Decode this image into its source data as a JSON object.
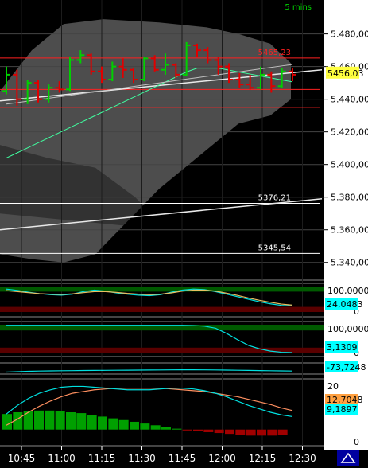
{
  "header": {
    "interval_label": "5 mins"
  },
  "colors": {
    "up": "#00d000",
    "down": "#e00000",
    "axis_bg": "#ffffff",
    "grid": "#444444",
    "band_fill": "#5a5a5a",
    "resistance": "#ff2020",
    "support_white": "#ffffff"
  },
  "chart_data": [
    {
      "type": "candlestick",
      "title": "",
      "x_ticks": [
        "10:45",
        "11:00",
        "11:15",
        "11:30",
        "11:45",
        "12:00",
        "12:15",
        "12:30"
      ],
      "y_ticks": [
        5480,
        5460,
        5440,
        5420,
        5400,
        5380,
        5360,
        5340
      ],
      "ylim": [
        5335,
        5492
      ],
      "last_price": "5456,03",
      "annotations": [
        {
          "text": "5465,23",
          "value": 5465.23,
          "color": "#ff2020"
        },
        {
          "text": "5376,21",
          "value": 5376.21,
          "color": "#ffffff"
        },
        {
          "text": "5345,54",
          "value": 5345.54,
          "color": "#ffffff"
        }
      ],
      "horizontal_lines": [
        {
          "value": 5465.23,
          "color": "#ff2020"
        },
        {
          "value": 5446,
          "color": "#ff2020"
        },
        {
          "value": 5435,
          "color": "#ff2020"
        },
        {
          "value": 5376.21,
          "color": "#ffffff"
        },
        {
          "value": 5345.54,
          "color": "#ffffff"
        }
      ],
      "bars": [
        {
          "time": "10:35",
          "o": 5445,
          "h": 5460,
          "l": 5443,
          "c": 5455
        },
        {
          "time": "10:40",
          "o": 5455,
          "h": 5458,
          "l": 5436,
          "c": 5440
        },
        {
          "time": "10:45",
          "o": 5440,
          "h": 5452,
          "l": 5437,
          "c": 5450
        },
        {
          "time": "10:50",
          "o": 5450,
          "h": 5452,
          "l": 5438,
          "c": 5440
        },
        {
          "time": "10:55",
          "o": 5440,
          "h": 5449,
          "l": 5438,
          "c": 5447
        },
        {
          "time": "11:00",
          "o": 5447,
          "h": 5451,
          "l": 5444,
          "c": 5446
        },
        {
          "time": "11:05",
          "o": 5446,
          "h": 5466,
          "l": 5445,
          "c": 5464
        },
        {
          "time": "11:10",
          "o": 5464,
          "h": 5470,
          "l": 5462,
          "c": 5467
        },
        {
          "time": "11:15",
          "o": 5467,
          "h": 5468,
          "l": 5455,
          "c": 5457
        },
        {
          "time": "11:20",
          "o": 5457,
          "h": 5460,
          "l": 5450,
          "c": 5452
        },
        {
          "time": "11:25",
          "o": 5452,
          "h": 5463,
          "l": 5451,
          "c": 5460
        },
        {
          "time": "11:30",
          "o": 5460,
          "h": 5465,
          "l": 5453,
          "c": 5458
        },
        {
          "time": "11:35",
          "o": 5458,
          "h": 5459,
          "l": 5450,
          "c": 5452
        },
        {
          "time": "11:40",
          "o": 5452,
          "h": 5466,
          "l": 5451,
          "c": 5465
        },
        {
          "time": "11:45",
          "o": 5465,
          "h": 5467,
          "l": 5457,
          "c": 5458
        },
        {
          "time": "11:50",
          "o": 5458,
          "h": 5468,
          "l": 5455,
          "c": 5461
        },
        {
          "time": "11:55",
          "o": 5461,
          "h": 5462,
          "l": 5453,
          "c": 5455
        },
        {
          "time": "12:00",
          "o": 5455,
          "h": 5475,
          "l": 5454,
          "c": 5473
        },
        {
          "time": "12:05",
          "o": 5473,
          "h": 5474,
          "l": 5466,
          "c": 5470
        },
        {
          "time": "12:10",
          "o": 5470,
          "h": 5472,
          "l": 5462,
          "c": 5464
        },
        {
          "time": "12:15",
          "o": 5464,
          "h": 5466,
          "l": 5455,
          "c": 5460
        },
        {
          "time": "12:20",
          "o": 5460,
          "h": 5462,
          "l": 5450,
          "c": 5452
        },
        {
          "time": "12:25",
          "o": 5452,
          "h": 5456,
          "l": 5447,
          "c": 5449
        },
        {
          "time": "12:30",
          "o": 5449,
          "h": 5455,
          "l": 5446,
          "c": 5447
        },
        {
          "time": "12:35",
          "o": 5447,
          "h": 5460,
          "l": 5446,
          "c": 5455
        },
        {
          "time": "12:40",
          "o": 5455,
          "h": 5457,
          "l": 5444,
          "c": 5448
        },
        {
          "time": "12:45",
          "o": 5448,
          "h": 5459,
          "l": 5447,
          "c": 5457
        },
        {
          "time": "12:50",
          "o": 5457,
          "h": 5459,
          "l": 5451,
          "c": 5455
        }
      ]
    },
    {
      "type": "line",
      "title": "",
      "y_ticks": [
        "100,0000",
        "0"
      ],
      "ylim": [
        0,
        100
      ],
      "last_value": "24,0483",
      "series": [
        {
          "color": "#00e0e0",
          "values": [
            90,
            85,
            78,
            72,
            68,
            66,
            70,
            80,
            86,
            82,
            75,
            70,
            66,
            64,
            68,
            78,
            86,
            90,
            88,
            80,
            70,
            60,
            50,
            40,
            32,
            26,
            24
          ]
        },
        {
          "color": "#e8c060",
          "values": [
            84,
            80,
            76,
            72,
            70,
            69,
            71,
            76,
            80,
            80,
            77,
            73,
            70,
            68,
            70,
            75,
            82,
            86,
            86,
            82,
            74,
            65,
            55,
            46,
            38,
            31,
            27
          ]
        }
      ]
    },
    {
      "type": "line",
      "title": "",
      "y_ticks": [
        "100,0000",
        "0"
      ],
      "ylim": [
        0,
        100
      ],
      "last_value": "3,1309",
      "series": [
        {
          "color": "#00e0e0",
          "values": [
            98,
            98,
            98,
            98,
            98,
            98,
            98,
            98,
            98,
            98,
            98,
            98,
            98,
            98,
            98,
            98,
            98,
            97,
            95,
            88,
            70,
            48,
            28,
            16,
            8,
            4,
            3
          ]
        }
      ]
    },
    {
      "type": "line",
      "title": "",
      "last_value": "-73,7248",
      "series": [
        {
          "color": "#00e0e0",
          "values": [
            5,
            10,
            15,
            18,
            20,
            22,
            23,
            25,
            26,
            27,
            28,
            29,
            30,
            31,
            32,
            33,
            34,
            34,
            33,
            32,
            30,
            28,
            26,
            24,
            22,
            20,
            18
          ]
        }
      ]
    },
    {
      "type": "bar",
      "title": "",
      "y_ticks": [
        "20",
        "0"
      ],
      "ylim": [
        -15,
        55
      ],
      "last_values": [
        "12,7048",
        "9,1897"
      ],
      "histogram": [
        18,
        20,
        21,
        22,
        22,
        21,
        20,
        19,
        17,
        15,
        13,
        11,
        9,
        7,
        5,
        3,
        1,
        -1,
        -2,
        -3,
        -4,
        -5,
        -6,
        -7,
        -7,
        -7,
        -6
      ],
      "series": [
        {
          "color": "#ff9060",
          "values": [
            5,
            12,
            20,
            27,
            33,
            38,
            42,
            44,
            46,
            47,
            48,
            48,
            48,
            48,
            48,
            47,
            46,
            45,
            44,
            42,
            40,
            38,
            35,
            32,
            29,
            25,
            22
          ]
        },
        {
          "color": "#00e0e0",
          "values": [
            18,
            28,
            36,
            42,
            46,
            49,
            50,
            50,
            49,
            48,
            47,
            46,
            46,
            46,
            47,
            48,
            48,
            47,
            45,
            42,
            38,
            33,
            28,
            24,
            20,
            17,
            15
          ]
        }
      ]
    }
  ]
}
